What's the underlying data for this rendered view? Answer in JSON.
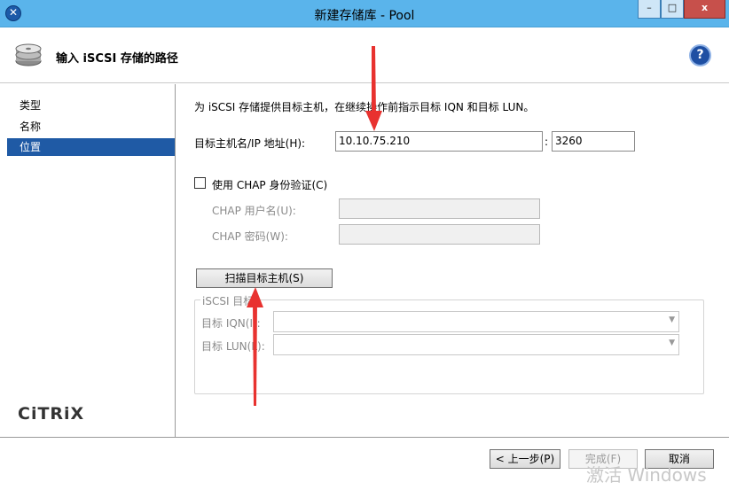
{
  "window": {
    "title": "新建存储库 - Pool",
    "minimize_glyph": "–",
    "maximize_glyph": "□",
    "close_glyph": "x"
  },
  "header": {
    "title": "输入 iSCSI 存储的路径",
    "help_glyph": "?"
  },
  "sidebar": {
    "items": [
      {
        "label": "类型"
      },
      {
        "label": "名称"
      },
      {
        "label": "位置"
      }
    ],
    "active_index": 2,
    "logo_text": "CiTRiX"
  },
  "form": {
    "description": "为 iSCSI 存储提供目标主机，在继续操作前指示目标 IQN 和目标 LUN。",
    "target_host_label": "目标主机名/IP 地址(H):",
    "target_host_value": "10.10.75.210",
    "port_separator": ":",
    "port_value": "3260",
    "chap_checkbox_label": "使用 CHAP 身份验证(C)",
    "chap_user_label": "CHAP 用户名(U):",
    "chap_password_label": "CHAP 密码(W):",
    "scan_button_label": "扫描目标主机(S)",
    "iscsi_group_title": "iSCSI 目标",
    "target_iqn_label": "目标 IQN(I):",
    "target_lun_label": "目标 LUN(L):"
  },
  "footer": {
    "back_button": "< 上一步(P)",
    "finish_button": "完成(F)",
    "cancel_button": "取消",
    "watermark": "激活 Windows"
  },
  "colors": {
    "titlebar": "#5ab4eb",
    "active_nav": "#1f5aa5",
    "annotation_arrow": "#e8322f"
  }
}
